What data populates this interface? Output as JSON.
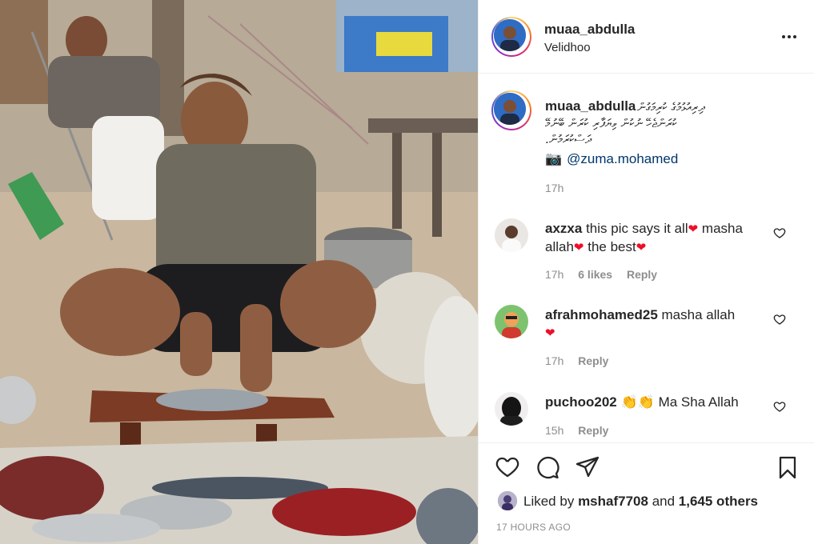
{
  "header": {
    "username": "muaa_abdulla",
    "location": "Velidhoo",
    "more_icon": "more-horizontal-icon"
  },
  "caption": {
    "username": "muaa_abdulla",
    "line1": "ދިރިއުޅުމުގެ ކުރިމަގުން",
    "line2": "ކުރަންޖެހޭ ނުކުން ވިޔަފާރި ކުރަން ބޭނުމޭ",
    "line3": ".ދަސްކުރަމުން",
    "camera": "📷",
    "mention": "@zuma.mohamed",
    "time": "17h"
  },
  "comments": [
    {
      "username": "axzxa",
      "text_a": "this pic says it all",
      "text_b": "masha",
      "text_c": "allah",
      "text_d": "the best",
      "time": "17h",
      "likes": "6 likes",
      "reply": "Reply"
    },
    {
      "username": "afrahmohamed25",
      "text_a": "masha allah",
      "time": "17h",
      "reply": "Reply"
    },
    {
      "username": "puchoo202",
      "text_a": "Ma Sha Allah",
      "time": "15h",
      "reply": "Reply"
    }
  ],
  "actions": {
    "like_icon": "heart-outline-icon",
    "comment_icon": "comment-icon",
    "share_icon": "paper-plane-icon",
    "save_icon": "bookmark-icon"
  },
  "likes": {
    "prefix": "Liked by",
    "user": "mshaf7708",
    "conj": "and",
    "count": "1,645 others"
  },
  "post_time": "17 HOURS AGO",
  "colors": {
    "link": "#00376b",
    "muted": "#8e8e8e",
    "heart": "#ed0f2a",
    "border": "#efefef"
  }
}
